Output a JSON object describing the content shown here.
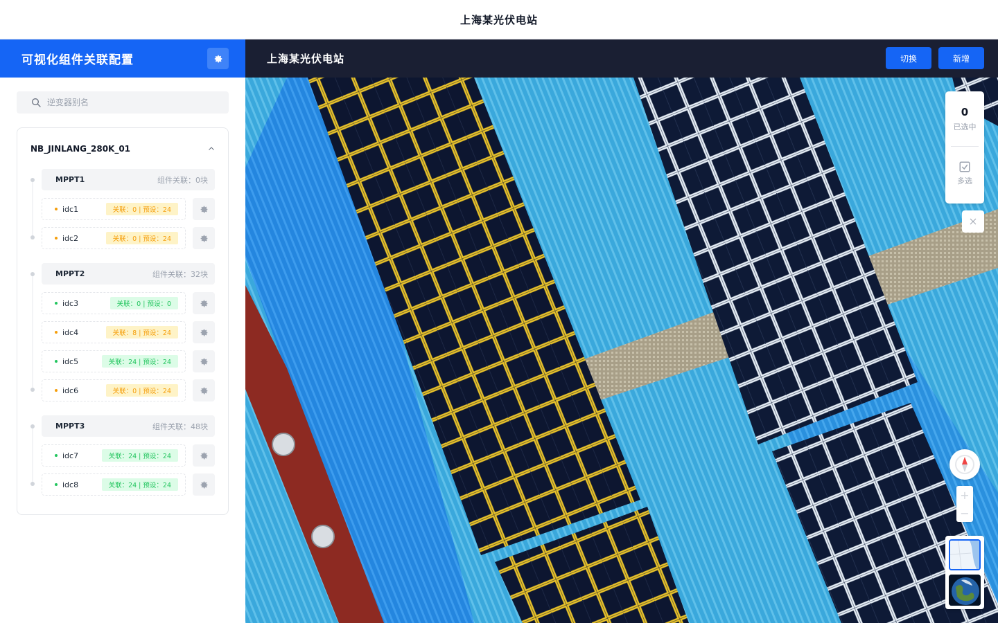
{
  "app": {
    "title": "上海某光伏电站"
  },
  "sidebar": {
    "title": "可视化组件关联配置",
    "search_placeholder": "逆变器别名",
    "inverter": {
      "name": "NB_JINLANG_280K_01",
      "mppts": [
        {
          "name": "MPPT1",
          "count": "组件关联：0块"
        },
        {
          "name": "MPPT2",
          "count": "组件关联：32块"
        },
        {
          "name": "MPPT3",
          "count": "组件关联：48块"
        }
      ],
      "idcs": [
        {
          "name": "idc1",
          "status": "关联：0 | 预设：24",
          "color": "#f59e0b"
        },
        {
          "name": "idc2",
          "status": "关联：0 | 预设：24",
          "color": "#f59e0b"
        },
        {
          "name": "idc3",
          "status": "关联：0 | 预设：0",
          "color": "#22c55e"
        },
        {
          "name": "idc4",
          "status": "关联：8 | 预设：24",
          "color": "#f59e0b"
        },
        {
          "name": "idc5",
          "status": "关联：24 | 预设：24",
          "color": "#22c55e"
        },
        {
          "name": "idc6",
          "status": "关联：0 | 预设：24",
          "color": "#f59e0b"
        },
        {
          "name": "idc7",
          "status": "关联：24 | 预设：24",
          "color": "#22c55e"
        },
        {
          "name": "idc8",
          "status": "关联：24 | 预设：24",
          "color": "#22c55e"
        }
      ]
    }
  },
  "main": {
    "title": "上海某光伏电站",
    "switch_label": "切换",
    "add_label": "新增",
    "selected_count": "0",
    "selected_label": "已选中",
    "multi_select_label": "多选",
    "zoom_in": "+",
    "zoom_out": "−"
  },
  "colors": {
    "primary": "#1565f5",
    "header_dark": "#1a1f33",
    "warning": "#f59e0b",
    "success": "#22c55e"
  }
}
